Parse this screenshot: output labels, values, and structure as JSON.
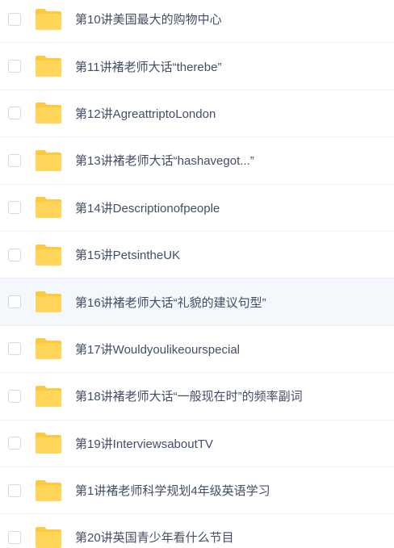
{
  "colors": {
    "folder": "#ffd659",
    "folder_tab": "#ffca3a",
    "text": "#424e67",
    "highlight_bg": "#f4f7fc",
    "divider": "#f0f1f5"
  },
  "files": [
    {
      "name": "第10讲美国最大的购物中心",
      "icon": "folder-icon",
      "highlighted": false
    },
    {
      "name": "第11讲褚老师大话“therebe”",
      "icon": "folder-icon",
      "highlighted": false
    },
    {
      "name": "第12讲AgreattriptoLondon",
      "icon": "folder-icon",
      "highlighted": false
    },
    {
      "name": "第13讲褚老师大话“hashavegot...”",
      "icon": "folder-icon",
      "highlighted": false
    },
    {
      "name": "第14讲Descriptionofpeople",
      "icon": "folder-icon",
      "highlighted": false
    },
    {
      "name": "第15讲PetsintheUK",
      "icon": "folder-icon",
      "highlighted": false
    },
    {
      "name": "第16讲褚老师大话“礼貌的建议句型”",
      "icon": "folder-icon",
      "highlighted": true
    },
    {
      "name": "第17讲Wouldyoulikeourspecial",
      "icon": "folder-icon",
      "highlighted": false
    },
    {
      "name": "第18讲褚老师大话“一般现在时”的频率副词",
      "icon": "folder-icon",
      "highlighted": false
    },
    {
      "name": "第19讲InterviewsaboutTV",
      "icon": "folder-icon",
      "highlighted": false
    },
    {
      "name": "第1讲褚老师科学规划4年级英语学习",
      "icon": "folder-icon",
      "highlighted": false
    },
    {
      "name": "第20讲英国青少年看什么节目",
      "icon": "folder-icon",
      "highlighted": false
    }
  ]
}
